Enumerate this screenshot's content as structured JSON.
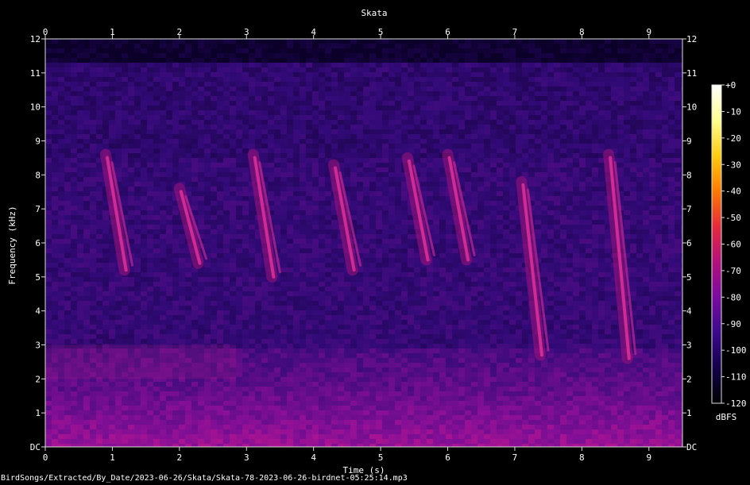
{
  "chart_data": {
    "type": "heatmap",
    "title": "Skata",
    "xlabel": "Time (s)",
    "ylabel": "Frequency (kHz)",
    "xlim": [
      0,
      9.5
    ],
    "ylim": [
      0,
      12
    ],
    "x_ticks": [
      "0",
      "1",
      "2",
      "3",
      "4",
      "5",
      "6",
      "7",
      "8",
      "9"
    ],
    "y_ticks": [
      "DC",
      "1",
      "2",
      "3",
      "4",
      "5",
      "6",
      "7",
      "8",
      "9",
      "10",
      "11",
      "12"
    ],
    "colorbar": {
      "label": "dBFS",
      "ticks": [
        "+0",
        "-10",
        "-20",
        "-30",
        "-40",
        "-50",
        "-60",
        "-70",
        "-80",
        "-90",
        "-100",
        "-110",
        "-120"
      ],
      "range": [
        -120,
        0
      ],
      "colors": [
        "#000000",
        "#12004a",
        "#3c0a8c",
        "#7a0aa0",
        "#b4107c",
        "#e62a3c",
        "#ff7a00",
        "#ffcc10",
        "#ffff90",
        "#ffffff"
      ]
    },
    "calls": [
      {
        "t": 0.9,
        "f_high": 8.6,
        "f_low": 5.2
      },
      {
        "t": 2.0,
        "f_high": 7.6,
        "f_low": 5.4
      },
      {
        "t": 3.1,
        "f_high": 8.6,
        "f_low": 5.0
      },
      {
        "t": 4.3,
        "f_high": 8.3,
        "f_low": 5.2
      },
      {
        "t": 5.4,
        "f_high": 8.5,
        "f_low": 5.5
      },
      {
        "t": 6.0,
        "f_high": 8.6,
        "f_low": 5.5
      },
      {
        "t": 7.1,
        "f_high": 7.8,
        "f_low": 2.7
      },
      {
        "t": 8.4,
        "f_high": 8.6,
        "f_low": 2.6
      }
    ]
  },
  "footer": "BirdSongs/Extracted/By_Date/2023-06-26/Skata/Skata-78-2023-06-26-birdnet-05:25:14.mp3"
}
